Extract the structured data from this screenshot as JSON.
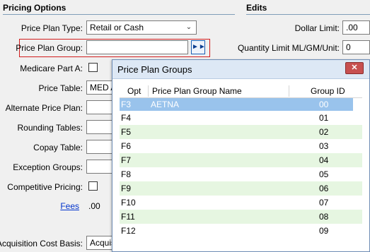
{
  "pricing": {
    "title": "Pricing Options",
    "plan_type_label": "Price Plan Type:",
    "plan_type_value": "Retail or Cash",
    "plan_group_label": "Price Plan Group:",
    "plan_group_value": "",
    "medicare_label": "Medicare Part A:",
    "price_table_label": "Price Table:",
    "price_table_value": "MED A",
    "alt_plan_label": "Alternate Price Plan:",
    "rounding_label": "Rounding Tables:",
    "copay_label": "Copay Table:",
    "exception_label": "Exception Groups:",
    "competitive_label": "Competitive Pricing:",
    "fees_label": "Fees",
    "fees_value": ".00",
    "acq_label": "Acquisition Cost Basis:",
    "acq_value": "Acquis"
  },
  "edits": {
    "title": "Edits",
    "dollar_label": "Dollar Limit:",
    "dollar_value": ".00",
    "qty_label": "Quantity Limit ML/GM/Unit:",
    "qty_value": "0"
  },
  "popup": {
    "title": "Price Plan Groups",
    "close_icon": "close-icon",
    "columns": [
      "Opt",
      "Price Plan Group Name",
      "Group ID"
    ],
    "rows": [
      {
        "opt": "F3",
        "name": "AETNA",
        "id": "00"
      },
      {
        "opt": "F4",
        "name": "",
        "id": "01"
      },
      {
        "opt": "F5",
        "name": "",
        "id": "02"
      },
      {
        "opt": "F6",
        "name": "",
        "id": "03"
      },
      {
        "opt": "F7",
        "name": "",
        "id": "04"
      },
      {
        "opt": "F8",
        "name": "",
        "id": "05"
      },
      {
        "opt": "F9",
        "name": "",
        "id": "06"
      },
      {
        "opt": "F10",
        "name": "",
        "id": "07"
      },
      {
        "opt": "F11",
        "name": "",
        "id": "08"
      },
      {
        "opt": "F12",
        "name": "",
        "id": "09"
      }
    ]
  },
  "colors": {
    "selected_row": "#99c3ec",
    "alt_row": "#e6f6e1",
    "highlight_border": "#d21d1d"
  }
}
